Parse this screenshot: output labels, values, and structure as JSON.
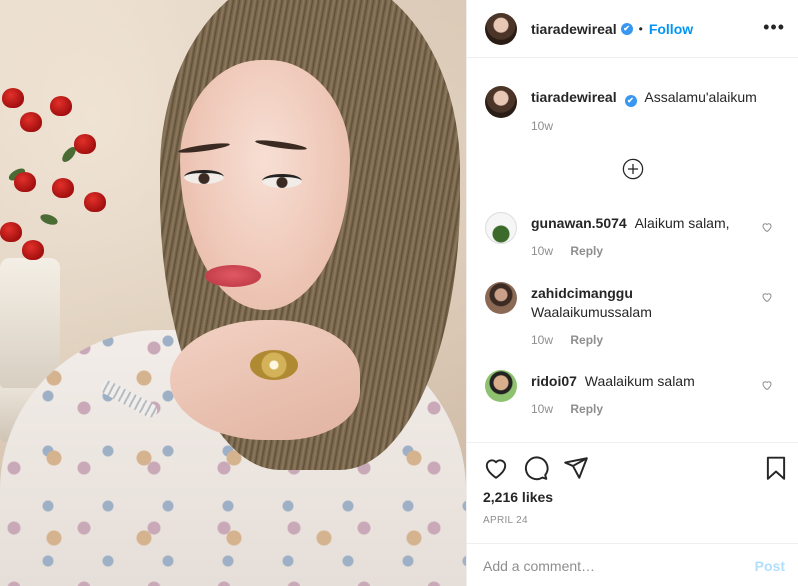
{
  "post": {
    "username": "tiaradewireal",
    "verified_mark": "✔",
    "separator": "•",
    "follow_label": "Follow",
    "more_label": "•••",
    "caption": "Assalamu'alaikum",
    "caption_time": "10w"
  },
  "comments": [
    {
      "username": "gunawan.5074",
      "text": "Alaikum salam,",
      "time": "10w",
      "reply_label": "Reply",
      "avatar_icon": "avatar-icon"
    },
    {
      "username": "zahidcimanggu",
      "text": "Waalaikumussalam",
      "time": "10w",
      "reply_label": "Reply",
      "avatar_icon": "avatar-icon"
    },
    {
      "username": "ridoi07",
      "text": "Waalaikum salam",
      "time": "10w",
      "reply_label": "Reply",
      "avatar_icon": "avatar-icon"
    }
  ],
  "actions": {
    "likes": "2,216 likes",
    "date": "APRIL 24",
    "icons": [
      "heart-icon",
      "comment-icon",
      "share-icon",
      "bookmark-icon",
      "plus-circle-icon"
    ]
  },
  "composer": {
    "placeholder": "Add a comment…",
    "post_label": "Post"
  },
  "colors": {
    "accent": "#0095f6",
    "verified": "#3897f0",
    "muted": "#8e8e8e",
    "post_disabled": "#b2dffc"
  }
}
